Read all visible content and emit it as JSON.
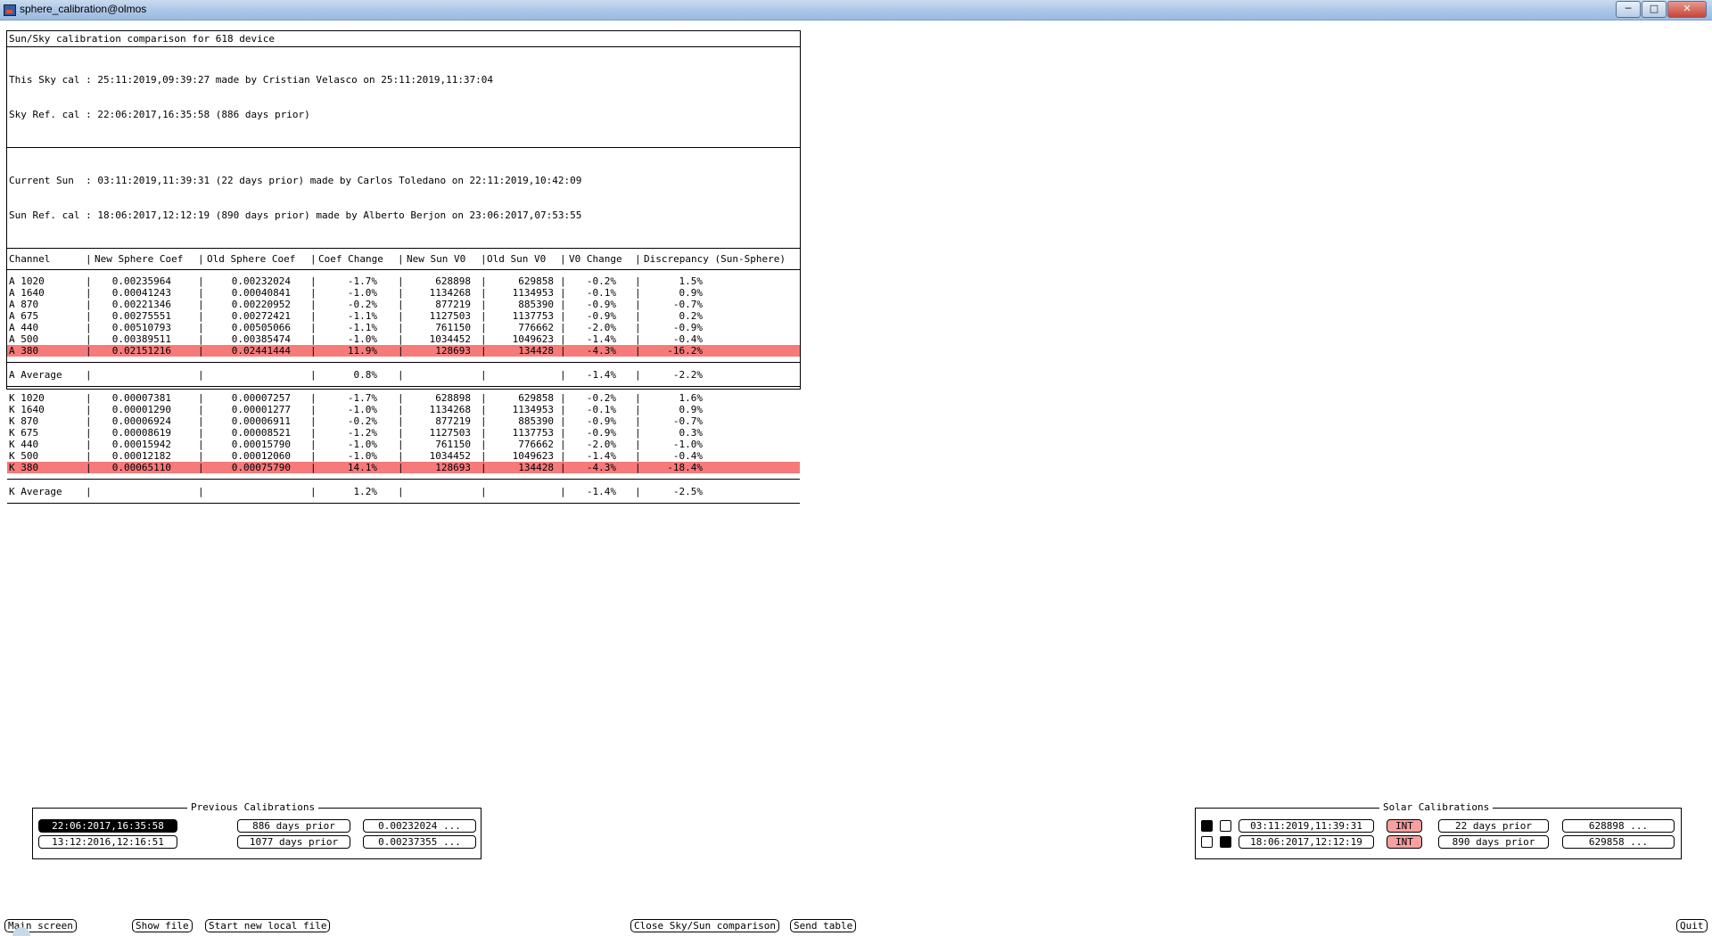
{
  "window": {
    "title": "sphere_calibration@olmos",
    "buttons": [
      "minimize",
      "maximize",
      "close"
    ]
  },
  "panel": {
    "header": "Sun/Sky calibration comparison for 618 device",
    "sky_lines": [
      "This Sky cal : 25:11:2019,09:39:27 made by Cristian Velasco on 25:11:2019,11:37:04",
      "Sky Ref. cal : 22:06:2017,16:35:58 (886 days prior)"
    ],
    "sun_lines": [
      "Current Sun  : 03:11:2019,11:39:31 (22 days prior) made by Carlos Toledano on 22:11:2019,10:42:09",
      "Sun Ref. cal : 18:06:2017,12:12:19 (890 days prior) made by Alberto Berjon on 23:06:2017,07:53:55"
    ],
    "columns": [
      "Channel",
      "New Sphere Coef",
      "Old Sphere Coef",
      "Coef Change",
      "New Sun V0",
      "Old Sun V0",
      "V0 Change",
      "Discrepancy (Sun-Sphere)"
    ],
    "groups": [
      {
        "rows": [
          {
            "ch": "A 1020",
            "new": "0.00235964",
            "old": "0.00232024",
            "cc": "-1.7%",
            "nv0": "628898",
            "ov0": "629858",
            "vc": "-0.2%",
            "disc": "1.5%",
            "hl": false
          },
          {
            "ch": "A 1640",
            "new": "0.00041243",
            "old": "0.00040841",
            "cc": "-1.0%",
            "nv0": "1134268",
            "ov0": "1134953",
            "vc": "-0.1%",
            "disc": "0.9%",
            "hl": false
          },
          {
            "ch": "A 870",
            "new": "0.00221346",
            "old": "0.00220952",
            "cc": "-0.2%",
            "nv0": "877219",
            "ov0": "885390",
            "vc": "-0.9%",
            "disc": "-0.7%",
            "hl": false
          },
          {
            "ch": "A 675",
            "new": "0.00275551",
            "old": "0.00272421",
            "cc": "-1.1%",
            "nv0": "1127503",
            "ov0": "1137753",
            "vc": "-0.9%",
            "disc": "0.2%",
            "hl": false
          },
          {
            "ch": "A 440",
            "new": "0.00510793",
            "old": "0.00505066",
            "cc": "-1.1%",
            "nv0": "761150",
            "ov0": "776662",
            "vc": "-2.0%",
            "disc": "-0.9%",
            "hl": false
          },
          {
            "ch": "A 500",
            "new": "0.00389511",
            "old": "0.00385474",
            "cc": "-1.0%",
            "nv0": "1034452",
            "ov0": "1049623",
            "vc": "-1.4%",
            "disc": "-0.4%",
            "hl": false
          },
          {
            "ch": "A 380",
            "new": "0.02151216",
            "old": "0.02441444",
            "cc": "11.9%",
            "nv0": "128693",
            "ov0": "134428",
            "vc": "-4.3%",
            "disc": "-16.2%",
            "hl": true
          }
        ],
        "average": {
          "ch": "A  Average",
          "cc": "0.8%",
          "vc": "-1.4%",
          "disc": "-2.2%"
        }
      },
      {
        "rows": [
          {
            "ch": "K 1020",
            "new": "0.00007381",
            "old": "0.00007257",
            "cc": "-1.7%",
            "nv0": "628898",
            "ov0": "629858",
            "vc": "-0.2%",
            "disc": "1.6%",
            "hl": false
          },
          {
            "ch": "K 1640",
            "new": "0.00001290",
            "old": "0.00001277",
            "cc": "-1.0%",
            "nv0": "1134268",
            "ov0": "1134953",
            "vc": "-0.1%",
            "disc": "0.9%",
            "hl": false
          },
          {
            "ch": "K 870",
            "new": "0.00006924",
            "old": "0.00006911",
            "cc": "-0.2%",
            "nv0": "877219",
            "ov0": "885390",
            "vc": "-0.9%",
            "disc": "-0.7%",
            "hl": false
          },
          {
            "ch": "K 675",
            "new": "0.00008619",
            "old": "0.00008521",
            "cc": "-1.2%",
            "nv0": "1127503",
            "ov0": "1137753",
            "vc": "-0.9%",
            "disc": "0.3%",
            "hl": false
          },
          {
            "ch": "K 440",
            "new": "0.00015942",
            "old": "0.00015790",
            "cc": "-1.0%",
            "nv0": "761150",
            "ov0": "776662",
            "vc": "-2.0%",
            "disc": "-1.0%",
            "hl": false
          },
          {
            "ch": "K 500",
            "new": "0.00012182",
            "old": "0.00012060",
            "cc": "-1.0%",
            "nv0": "1034452",
            "ov0": "1049623",
            "vc": "-1.4%",
            "disc": "-0.4%",
            "hl": false
          },
          {
            "ch": "K 380",
            "new": "0.00065110",
            "old": "0.00075790",
            "cc": "14.1%",
            "nv0": "128693",
            "ov0": "134428",
            "vc": "-4.3%",
            "disc": "-18.4%",
            "hl": true
          }
        ],
        "average": {
          "ch": "K  Average",
          "cc": "1.2%",
          "vc": "-1.4%",
          "disc": "-2.5%"
        }
      }
    ],
    "highlight_color": "#f77a7a"
  },
  "previous_calibrations": {
    "title": "Previous Calibrations",
    "rows": [
      {
        "date": "22:06:2017,16:35:58",
        "days": "886 days prior",
        "coef": "0.00232024 ...",
        "selected": true
      },
      {
        "date": "13:12:2016,12:16:51",
        "days": "1077 days prior",
        "coef": "0.00237355 ...",
        "selected": false
      }
    ]
  },
  "solar_calibrations": {
    "title": "Solar Calibrations",
    "rows": [
      {
        "radio1": true,
        "radio2": false,
        "date": "03:11:2019,11:39:31",
        "tag": "INT",
        "days": "22 days prior",
        "v0": "628898 ..."
      },
      {
        "radio1": false,
        "radio2": true,
        "date": "18:06:2017,12:12:19",
        "tag": "INT",
        "days": "890 days prior",
        "v0": "629858 ..."
      }
    ],
    "tag_color": "#f7a0a0"
  },
  "bottom_bar": {
    "main_screen": "Main screen",
    "show_file": "Show file",
    "start_new_local_file": "Start new local file",
    "close_comparison": "Close Sky/Sun comparison",
    "send_table": "Send table",
    "quit": "Quit"
  }
}
